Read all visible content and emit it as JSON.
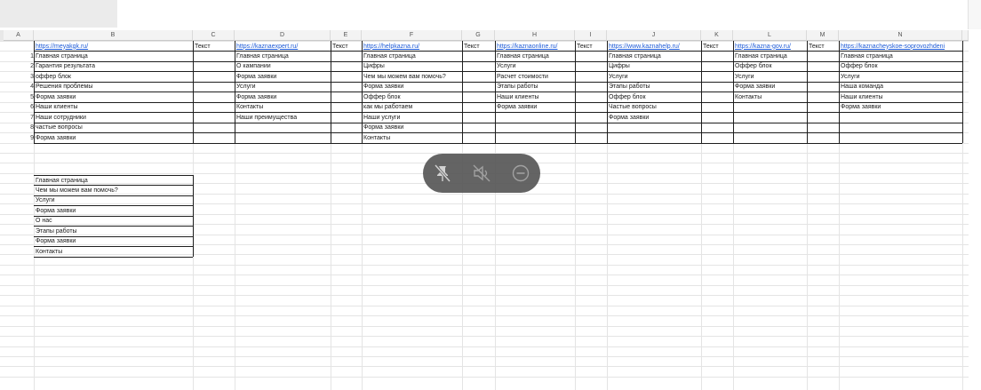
{
  "columns": [
    "A",
    "B",
    "C",
    "D",
    "E",
    "F",
    "G",
    "H",
    "I",
    "J",
    "K",
    "L",
    "M",
    "N"
  ],
  "header_row": {
    "B": "https://meyakgk.ru/",
    "C": "Текст",
    "D": "https://kaznaexpert.ru/",
    "E": "Текст",
    "F": "https://helpkazna.ru/",
    "G": "Текст",
    "H": "https://kaznaonline.ru/",
    "I": "Текст",
    "J": "https://www.kaznahelp.ru/",
    "K": "Текст",
    "L": "https://kazna-gov.ru/",
    "M": "Текст",
    "N": "https://kaznacheyskoe-soprovozhdeni"
  },
  "row_numbers": [
    "1",
    "2",
    "3",
    "4",
    "5",
    "6",
    "7",
    "8",
    "9"
  ],
  "table": {
    "B": [
      "Главная страница",
      "Гарантия результата",
      "оффер блок",
      "Решения проблемы",
      "Форма заявки",
      "Наши клиенты",
      "Наши сотрудники",
      "частые вопросы",
      "Форма заявки"
    ],
    "D": [
      "Главная страница",
      "О кампании",
      "Форма заявки",
      "Услуги",
      "Форма заявки",
      "Контакты",
      "Наши преимущества",
      "",
      ""
    ],
    "F": [
      "Главная страница",
      "Цифры",
      "Чем мы можем вам помочь?",
      "Форма заявки",
      "Оффер блок",
      "как мы работаем",
      "Наши услуги",
      "Форма заявки",
      "Контакты"
    ],
    "H": [
      "Главная страница",
      "Услуги",
      "Расчет стоимости",
      "Этапы работы",
      "Наши клиенты",
      "Форма заявки",
      "",
      "",
      ""
    ],
    "J": [
      "Главная страница",
      "Цифры",
      "Услуги",
      "Этапы работы",
      "Оффер блок",
      "Частые вопросы",
      "Форма заявки",
      "",
      ""
    ],
    "L": [
      "Главная страница",
      "Оффер блок",
      "Услуги",
      "Форма заявки",
      "Контакты",
      "",
      "",
      "",
      ""
    ],
    "N": [
      "Главная страница",
      "Оффер блок",
      "Услуги",
      "Наша команда",
      "Наши клиенты",
      "Форма заявки",
      "",
      "",
      ""
    ]
  },
  "summary_list": [
    "Главная страница",
    "Чем мы можем вам помочь?",
    "Услуги",
    "Форма заявки",
    "О нас",
    "Этапы работы",
    "Форма заявки",
    "Контакты"
  ],
  "toolbar": {
    "icons": [
      "unpin-icon",
      "mute-icon",
      "minimize-icon"
    ]
  },
  "colors": {
    "link": "#1d5ad6",
    "toolbar_bg": "#575757"
  }
}
